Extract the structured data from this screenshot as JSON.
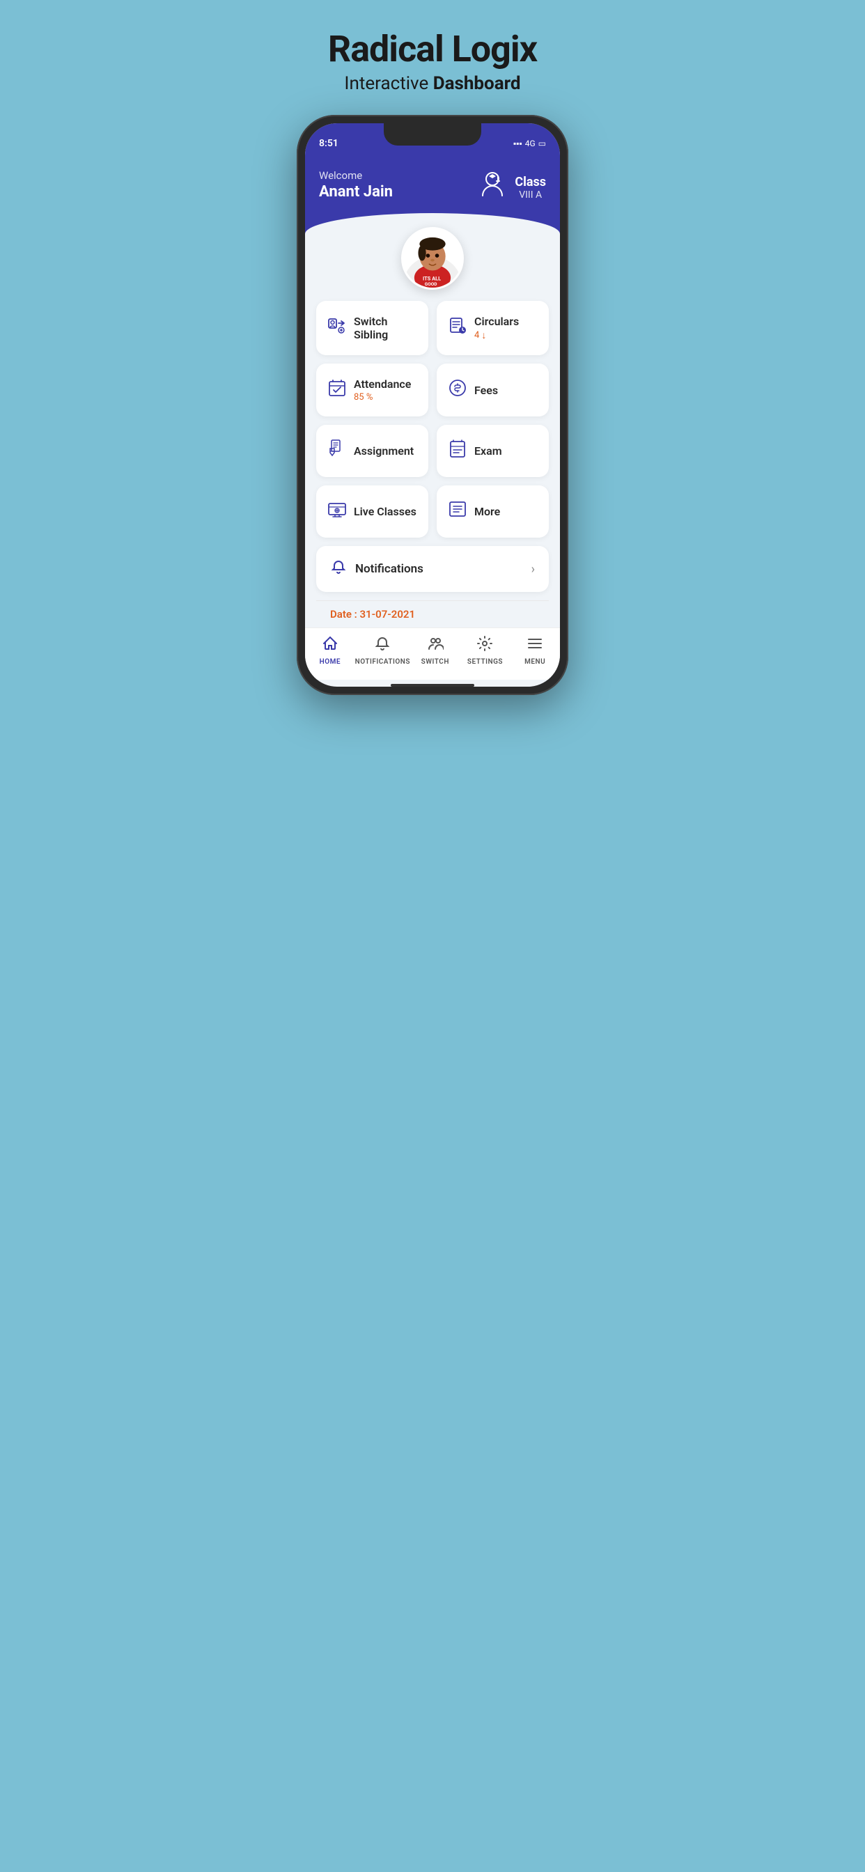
{
  "header": {
    "title": "Radical Logix",
    "subtitle_normal": "Interactive ",
    "subtitle_bold": "Dashboard"
  },
  "status_bar": {
    "time": "8:51",
    "network": "4G",
    "signal": "▪▪▪"
  },
  "welcome": {
    "greeting": "Welcome",
    "user_name": "Anant  Jain",
    "class_label": "Class",
    "class_name": "VIII A"
  },
  "cards": [
    {
      "id": "switch-sibling",
      "title": "Switch Sibling",
      "sub": "",
      "icon": "switch"
    },
    {
      "id": "circulars",
      "title": "Circulars",
      "sub": "4",
      "icon": "circulars"
    },
    {
      "id": "attendance",
      "title": "Attendance",
      "sub": "85 %",
      "icon": "attendance"
    },
    {
      "id": "fees",
      "title": "Fees",
      "sub": "",
      "icon": "fees"
    },
    {
      "id": "assignment",
      "title": "Assignment",
      "sub": "",
      "icon": "assignment"
    },
    {
      "id": "exam",
      "title": "Exam",
      "sub": "",
      "icon": "exam"
    },
    {
      "id": "live-classes",
      "title": "Live Classes",
      "sub": "",
      "icon": "live"
    },
    {
      "id": "more",
      "title": "More",
      "sub": "",
      "icon": "more"
    }
  ],
  "notifications": {
    "label": "Notifications"
  },
  "date": {
    "label": "Date : 31-07-2021"
  },
  "bottom_nav": [
    {
      "id": "home",
      "label": "HOME",
      "active": true
    },
    {
      "id": "notifications",
      "label": "NOTIFICATIONS",
      "active": false
    },
    {
      "id": "switch",
      "label": "SWITCH",
      "active": false
    },
    {
      "id": "settings",
      "label": "SETTINGS",
      "active": false
    },
    {
      "id": "menu",
      "label": "MENU",
      "active": false
    }
  ]
}
